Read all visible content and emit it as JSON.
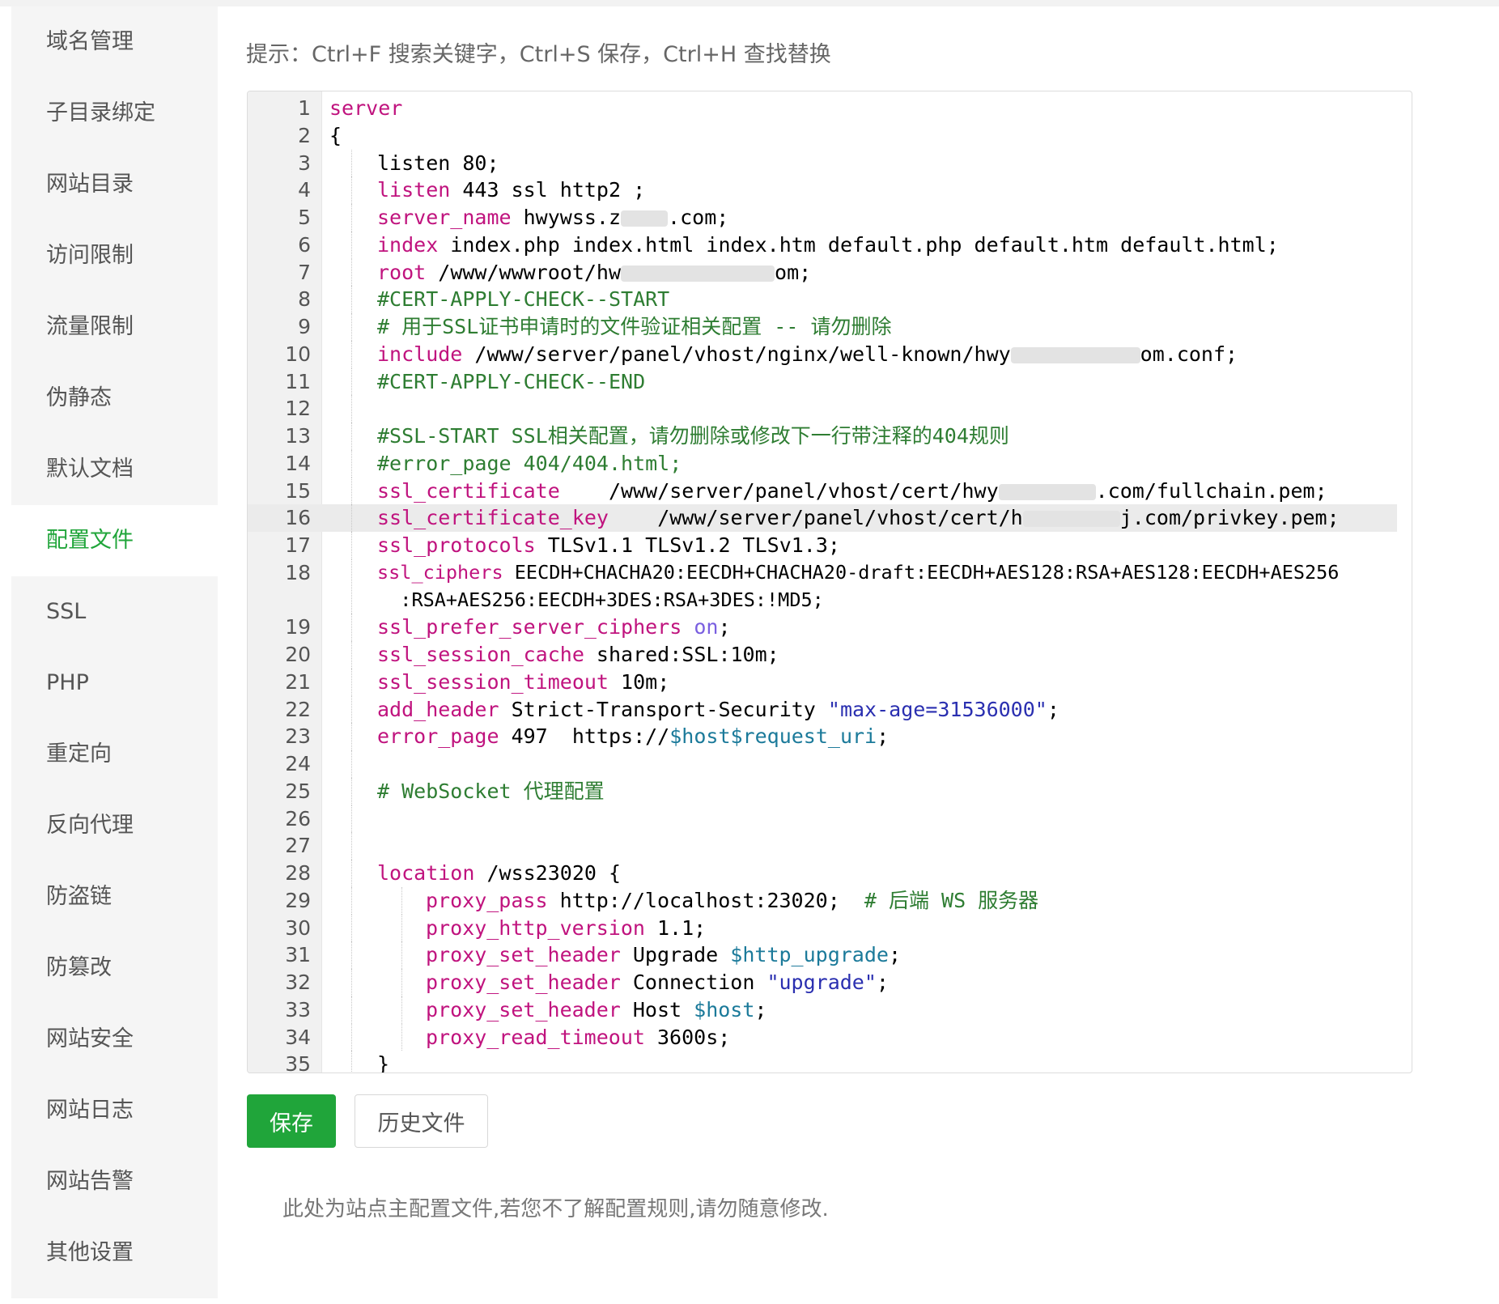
{
  "sidebar": {
    "items": [
      {
        "label": "域名管理"
      },
      {
        "label": "子目录绑定"
      },
      {
        "label": "网站目录"
      },
      {
        "label": "访问限制"
      },
      {
        "label": "流量限制"
      },
      {
        "label": "伪静态"
      },
      {
        "label": "默认文档"
      },
      {
        "label": "配置文件",
        "active": true
      },
      {
        "label": "SSL"
      },
      {
        "label": "PHP"
      },
      {
        "label": "重定向"
      },
      {
        "label": "反向代理"
      },
      {
        "label": "防盗链"
      },
      {
        "label": "防篡改"
      },
      {
        "label": "网站安全"
      },
      {
        "label": "网站日志"
      },
      {
        "label": "网站告警"
      },
      {
        "label": "其他设置"
      }
    ]
  },
  "editor": {
    "hint": "提示：Ctrl+F 搜索关键字，Ctrl+S 保存，Ctrl+H 查找替换",
    "active_line": 16,
    "lines": [
      "server",
      "{",
      "listen 80;",
      "listen 443 ssl http2 ;",
      "server_name hwywss.z[blurred].com;",
      "index index.php index.html index.htm default.php default.htm default.html;",
      "root /www/wwwroot/hw[blurred]om;",
      "#CERT-APPLY-CHECK--START",
      "# 用于SSL证书申请时的文件验证相关配置 -- 请勿删除",
      "include /www/server/panel/vhost/nginx/well-known/hwy[blurred]om.conf;",
      "#CERT-APPLY-CHECK--END",
      "",
      "#SSL-START SSL相关配置，请勿删除或修改下一行带注释的404规则",
      "#error_page 404/404.html;",
      "ssl_certificate    /www/server/panel/vhost/cert/hwy[blurred].com/fullchain.pem;",
      "ssl_certificate_key    /www/server/panel/vhost/cert/h[blurred]j.com/privkey.pem;",
      "ssl_protocols TLSv1.1 TLSv1.2 TLSv1.3;",
      "ssl_ciphers EECDH+CHACHA20:EECDH+CHACHA20-draft:EECDH+AES128:RSA+AES128:EECDH+AES256:RSA+AES256:EECDH+3DES:RSA+3DES:!MD5;",
      "ssl_prefer_server_ciphers on;",
      "ssl_session_cache shared:SSL:10m;",
      "ssl_session_timeout 10m;",
      "add_header Strict-Transport-Security \"max-age=31536000\";",
      "error_page 497  https://$host$request_uri;",
      "",
      "# WebSocket 代理配置",
      "",
      "",
      "location /wss23020 {",
      "proxy_pass http://localhost:23020;  # 后端 WS 服务器",
      "proxy_http_version 1.1;",
      "proxy_set_header Upgrade $http_upgrade;",
      "proxy_set_header Connection \"upgrade\";",
      "proxy_set_header Host $host;",
      "proxy_read_timeout 3600s;",
      "}"
    ],
    "line_numbers": [
      "1",
      "2",
      "3",
      "4",
      "5",
      "6",
      "7",
      "8",
      "9",
      "10",
      "11",
      "12",
      "13",
      "14",
      "15",
      "16",
      "17",
      "18",
      "19",
      "20",
      "21",
      "22",
      "23",
      "24",
      "25",
      "26",
      "27",
      "28",
      "29",
      "30",
      "31",
      "32",
      "33",
      "34",
      "35"
    ]
  },
  "actions": {
    "save_label": "保存",
    "history_label": "历史文件"
  },
  "footer_note": "此处为站点主配置文件,若您不了解配置规则,请勿随意修改.",
  "colors": {
    "accent": "#20a53a",
    "keyword": "#c0137e",
    "comment": "#2e7d32",
    "string": "#2a2fb0",
    "variable": "#1b7a9a"
  }
}
